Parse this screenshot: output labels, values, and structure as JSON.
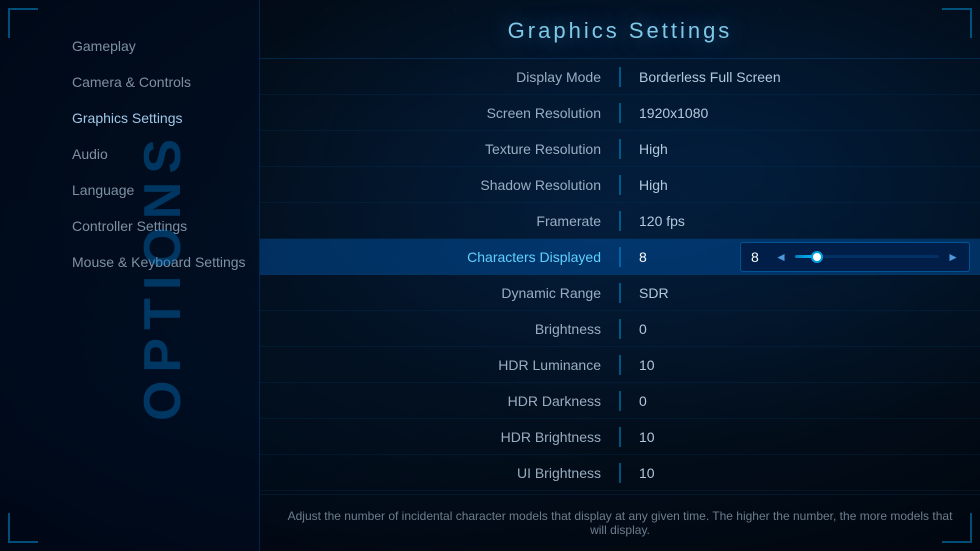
{
  "sidebar": {
    "options_label": "Options",
    "items": [
      {
        "id": "gameplay",
        "label": "Gameplay",
        "active": false
      },
      {
        "id": "camera-controls",
        "label": "Camera & Controls",
        "active": false
      },
      {
        "id": "graphics-settings",
        "label": "Graphics Settings",
        "active": true
      },
      {
        "id": "audio",
        "label": "Audio",
        "active": false
      },
      {
        "id": "language",
        "label": "Language",
        "active": false
      },
      {
        "id": "controller-settings",
        "label": "Controller Settings",
        "active": false
      },
      {
        "id": "mouse-keyboard",
        "label": "Mouse & Keyboard Settings",
        "active": false
      }
    ]
  },
  "main": {
    "title": "Graphics Settings",
    "settings": [
      {
        "id": "display-mode",
        "label": "Display Mode",
        "value": "Borderless Full Screen",
        "highlighted": false
      },
      {
        "id": "screen-resolution",
        "label": "Screen Resolution",
        "value": "1920x1080",
        "highlighted": false
      },
      {
        "id": "texture-resolution",
        "label": "Texture Resolution",
        "value": "High",
        "highlighted": false
      },
      {
        "id": "shadow-resolution",
        "label": "Shadow Resolution",
        "value": "High",
        "highlighted": false
      },
      {
        "id": "framerate",
        "label": "Framerate",
        "value": "120 fps",
        "highlighted": false
      },
      {
        "id": "characters-displayed",
        "label": "Characters Displayed",
        "value": "8",
        "highlighted": true
      },
      {
        "id": "dynamic-range",
        "label": "Dynamic Range",
        "value": "SDR",
        "highlighted": false
      },
      {
        "id": "brightness",
        "label": "Brightness",
        "value": "0",
        "highlighted": false
      },
      {
        "id": "hdr-luminance",
        "label": "HDR Luminance",
        "value": "10",
        "highlighted": false
      },
      {
        "id": "hdr-darkness",
        "label": "HDR Darkness",
        "value": "0",
        "highlighted": false
      },
      {
        "id": "hdr-brightness",
        "label": "HDR Brightness",
        "value": "10",
        "highlighted": false
      },
      {
        "id": "ui-brightness",
        "label": "UI Brightness",
        "value": "10",
        "highlighted": false
      }
    ],
    "slider": {
      "value": "8",
      "left_arrow": "◄",
      "right_arrow": "►"
    },
    "description": "Adjust the number of incidental character models that display at any given time. The higher the number, the more models that will display."
  }
}
